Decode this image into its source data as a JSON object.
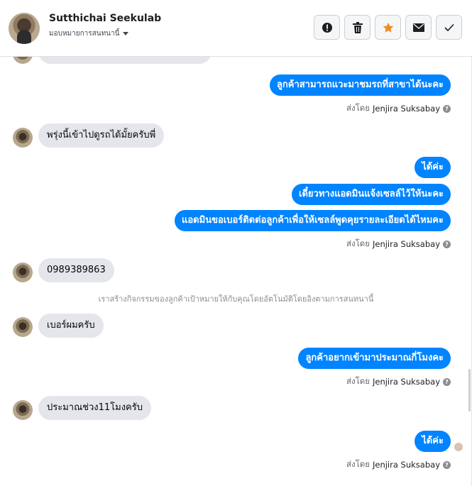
{
  "header": {
    "name": "Sutthichai Seekulab",
    "assign_label": "มอบหมายการสนทนานี้"
  },
  "actions": [
    {
      "icon": "alert-icon",
      "label": "spam"
    },
    {
      "icon": "trash-icon",
      "label": "delete"
    },
    {
      "icon": "star-icon",
      "label": "star"
    },
    {
      "icon": "mail-icon",
      "label": "mark-unread"
    },
    {
      "icon": "check-icon",
      "label": "done"
    }
  ],
  "colors": {
    "accent": "#0084ff",
    "star": "#f08a24",
    "incoming_bg": "#e4e6eb"
  },
  "messages": {
    "m1_out": "ลูกค้าสามารถแวะมาชมรถที่สาขาได้นะคะ",
    "m2_in": "พรุ่งนี้เข้าไปดูรถได้มั้ยครับพี่",
    "m3_out": "ได้ค่ะ",
    "m4_out": "เดี๋ยวทางแอดมินแจ้งเซลล์ไว้ให้นะคะ",
    "m5_out": "แอดมินขอเบอร์ติดต่อลูกค้าเพื่อให้เซลล์พูดคุยรายละเอียดได้ไหมคะ",
    "m6_in": "0989389863",
    "system": "เราสร้างกิจกรรมของลูกค้าเป้าหมายให้กับคุณโดยอัตโนมัติโดยอิงตามการสนทนานี้",
    "m7_in": "เบอร์ผมครับ",
    "m8_out": "ลูกค้าอยากเข้ามาประมาณกี่โมงคะ",
    "m9_in": "ประมาณช่วง11โมงครับ",
    "m10_out": "ได้ค่ะ"
  },
  "sent_by": {
    "prefix": "ส่งโดย",
    "agent": "Jenjira Suksabay"
  }
}
